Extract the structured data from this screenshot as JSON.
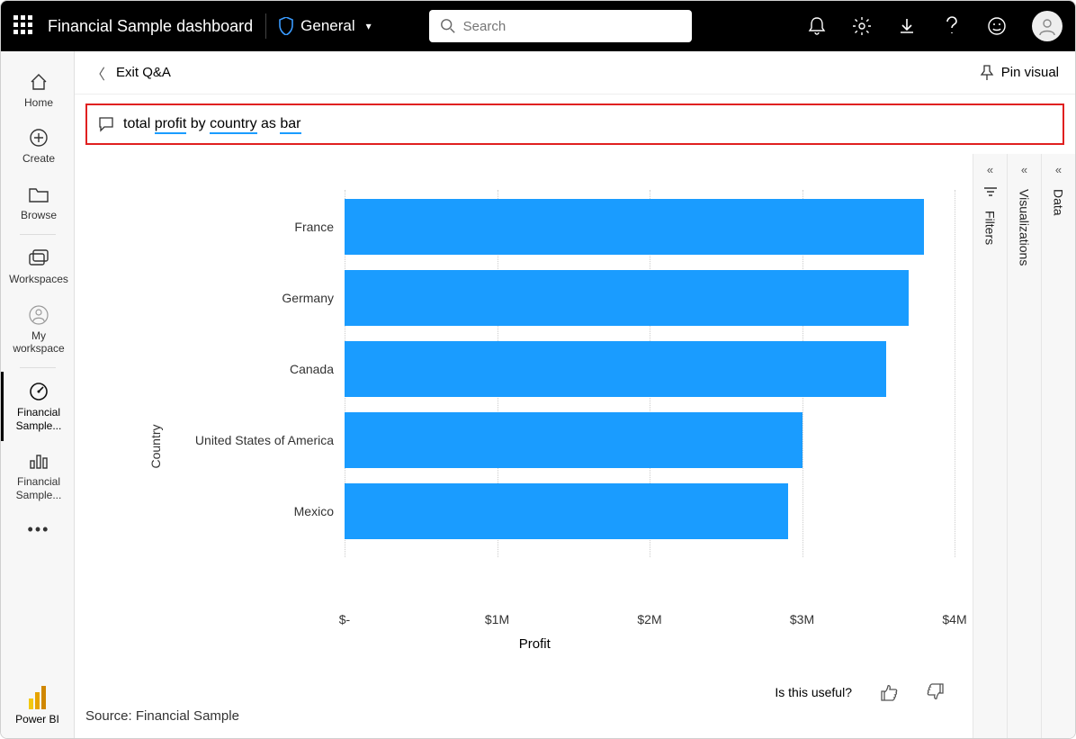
{
  "header": {
    "app_title": "Financial Sample dashboard",
    "classification": "General",
    "search_placeholder": "Search"
  },
  "leftnav": {
    "home": "Home",
    "create": "Create",
    "browse": "Browse",
    "workspaces": "Workspaces",
    "myworkspace": "My workspace",
    "fin1": "Financial Sample...",
    "fin2": "Financial Sample...",
    "footer": "Power BI"
  },
  "crumb": {
    "exit": "Exit Q&A",
    "pin": "Pin visual"
  },
  "qna": {
    "w1": "total",
    "w2": "profit",
    "w3": "by",
    "w4": "country",
    "w5": "as",
    "w6": "bar"
  },
  "panes": {
    "filters": "Filters",
    "viz": "Visualizations",
    "data": "Data"
  },
  "feedback": {
    "useful": "Is this useful?"
  },
  "source": "Source: Financial Sample",
  "chart_data": {
    "type": "bar",
    "orientation": "horizontal",
    "ylabel": "Country",
    "xlabel": "Profit",
    "xlim": [
      0,
      4000000
    ],
    "ticks": [
      "$-",
      "$1M",
      "$2M",
      "$3M",
      "$4M"
    ],
    "categories": [
      "France",
      "Germany",
      "Canada",
      "United States of America",
      "Mexico"
    ],
    "values": [
      3800000,
      3700000,
      3550000,
      3000000,
      2910000
    ],
    "color": "#1a9cff"
  }
}
